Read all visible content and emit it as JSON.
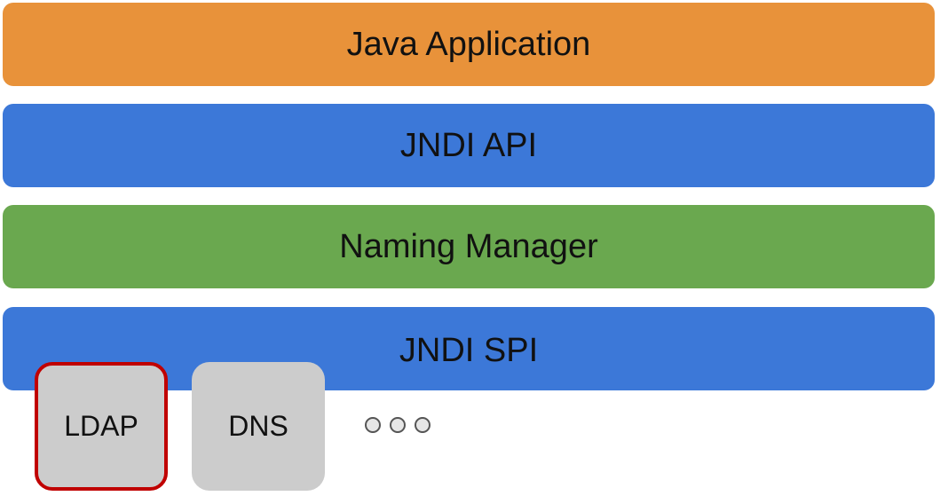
{
  "layers": [
    {
      "label": "Java Application",
      "color": "#e8923a"
    },
    {
      "label": "JNDI API",
      "color": "#3c78d8"
    },
    {
      "label": "Naming Manager",
      "color": "#6aa84f"
    },
    {
      "label": "JNDI SPI",
      "color": "#3c78d8"
    }
  ],
  "providers": [
    {
      "label": "LDAP",
      "color": "#cccccc",
      "border_color": "#c00000",
      "highlighted": true
    },
    {
      "label": "DNS",
      "color": "#cccccc",
      "highlighted": false
    }
  ],
  "more_indicator": {
    "icon": "ellipsis-circles-icon",
    "count": 3
  }
}
